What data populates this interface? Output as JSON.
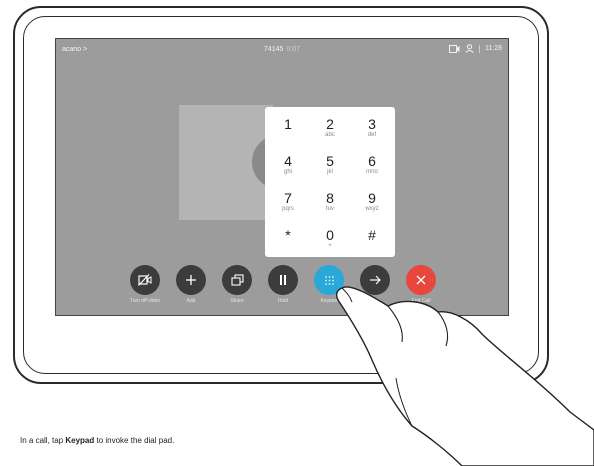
{
  "status_bar": {
    "left": "acano >",
    "number": "74145",
    "duration": "0:07",
    "time": "11:28"
  },
  "keypad": {
    "keys": [
      {
        "digit": "1",
        "letters": ""
      },
      {
        "digit": "2",
        "letters": "abc"
      },
      {
        "digit": "3",
        "letters": "def"
      },
      {
        "digit": "4",
        "letters": "ghi"
      },
      {
        "digit": "5",
        "letters": "jkl"
      },
      {
        "digit": "6",
        "letters": "mno"
      },
      {
        "digit": "7",
        "letters": "pqrs"
      },
      {
        "digit": "8",
        "letters": "tuv"
      },
      {
        "digit": "9",
        "letters": "wxyz"
      },
      {
        "digit": "*",
        "letters": ""
      },
      {
        "digit": "0",
        "letters": "+"
      },
      {
        "digit": "#",
        "letters": ""
      }
    ]
  },
  "controls": [
    {
      "label": "Turn off video",
      "icon": "video-off-icon",
      "color": "#3c3c3c"
    },
    {
      "label": "Add",
      "icon": "plus-icon",
      "color": "#3c3c3c"
    },
    {
      "label": "Share",
      "icon": "share-icon",
      "color": "#3c3c3c"
    },
    {
      "label": "Hold",
      "icon": "pause-icon",
      "color": "#3c3c3c"
    },
    {
      "label": "Keypad",
      "icon": "keypad-icon",
      "color": "#2aa8d8"
    },
    {
      "label": "",
      "icon": "transfer-icon",
      "color": "#3c3c3c"
    },
    {
      "label": "End Call",
      "icon": "close-icon",
      "color": "#e8473e"
    }
  ],
  "caption": {
    "prefix": "In a call, tap ",
    "bold": "Keypad",
    "suffix": " to invoke the dial pad."
  }
}
